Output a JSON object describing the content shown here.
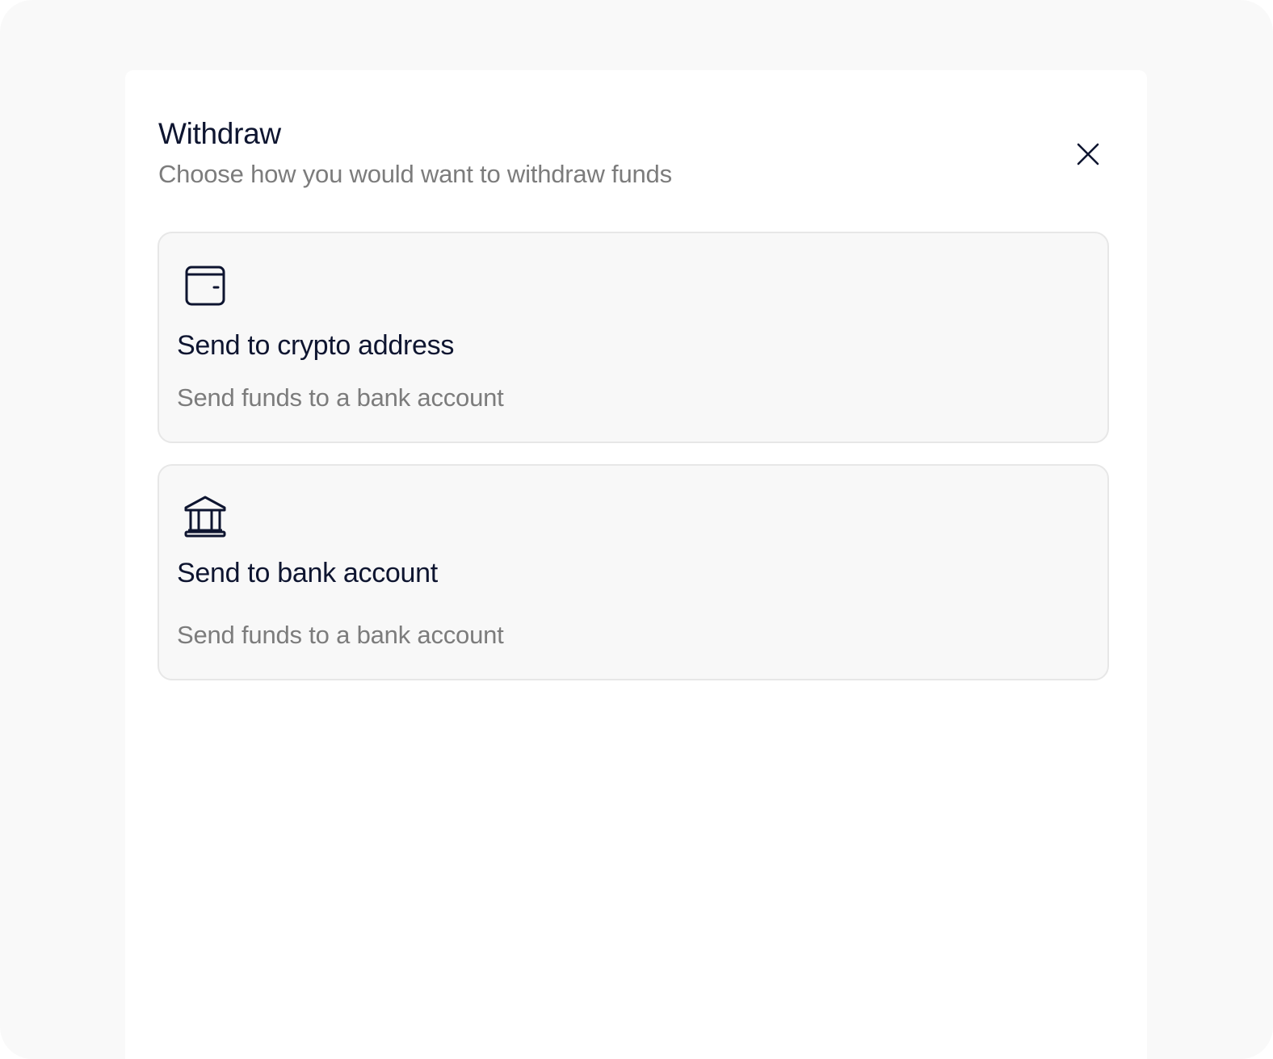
{
  "modal": {
    "title": "Withdraw",
    "subtitle": "Choose how you would want to withdraw funds",
    "close_icon": "close-icon"
  },
  "options": [
    {
      "icon": "wallet-icon",
      "title": "Send to crypto address",
      "description": "Send funds to a bank account"
    },
    {
      "icon": "bank-icon",
      "title": "Send to bank account",
      "description": "Send funds to a bank account"
    }
  ],
  "colors": {
    "backdrop": "#f9f9f9",
    "panel": "#ffffff",
    "card_background": "#f8f8f8",
    "card_border": "#e7e7e7",
    "heading_text": "#0e1530",
    "muted_text": "#7c7c7c"
  }
}
